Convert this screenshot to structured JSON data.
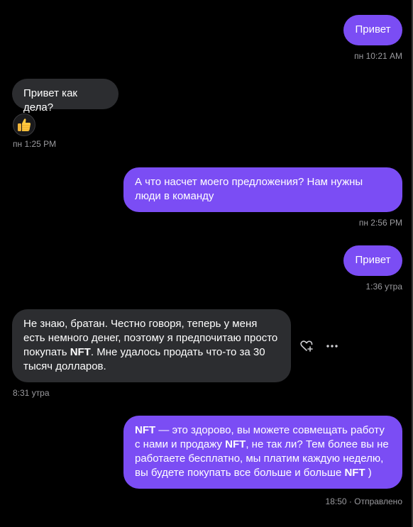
{
  "messages": [
    {
      "text": "Привет",
      "timestamp": "пн 10:21 AM"
    },
    {
      "text": "Привет как дела?",
      "reaction": "thumbs-up-emoji",
      "timestamp": "пн 1:25 PM"
    },
    {
      "text": "А что насчет моего предложения? Нам нужны люди в команду",
      "timestamp": "пн 2:56 PM"
    },
    {
      "text": "Привет",
      "timestamp": "1:36 утра"
    },
    {
      "parts": [
        "Не знаю, братан. Честно говоря, теперь у меня есть немного денег, поэтому я предпочитаю просто покупать ",
        "NFT",
        ". Мне удалось продать что-то за 30 тысяч долларов."
      ],
      "timestamp": "8:31 утра"
    },
    {
      "parts": [
        "NFT",
        " — это здорово, вы можете совмещать работу с нами и продажу ",
        "NFT",
        ", не так ли? Тем более вы не работаете бесплатно, мы платим каждую неделю, вы будете покупать все больше и больше ",
        "NFT",
        " )"
      ],
      "timestamp": "18:50",
      "status": "Отправлено"
    }
  ],
  "icons": {
    "react": "heart-plus-icon",
    "more": "more-horizontal-icon"
  },
  "colors": {
    "outgoing_bubble": "#7b4df4",
    "incoming_bubble": "#2c2d30",
    "background": "#000000",
    "timestamp": "#9a9a9e"
  }
}
